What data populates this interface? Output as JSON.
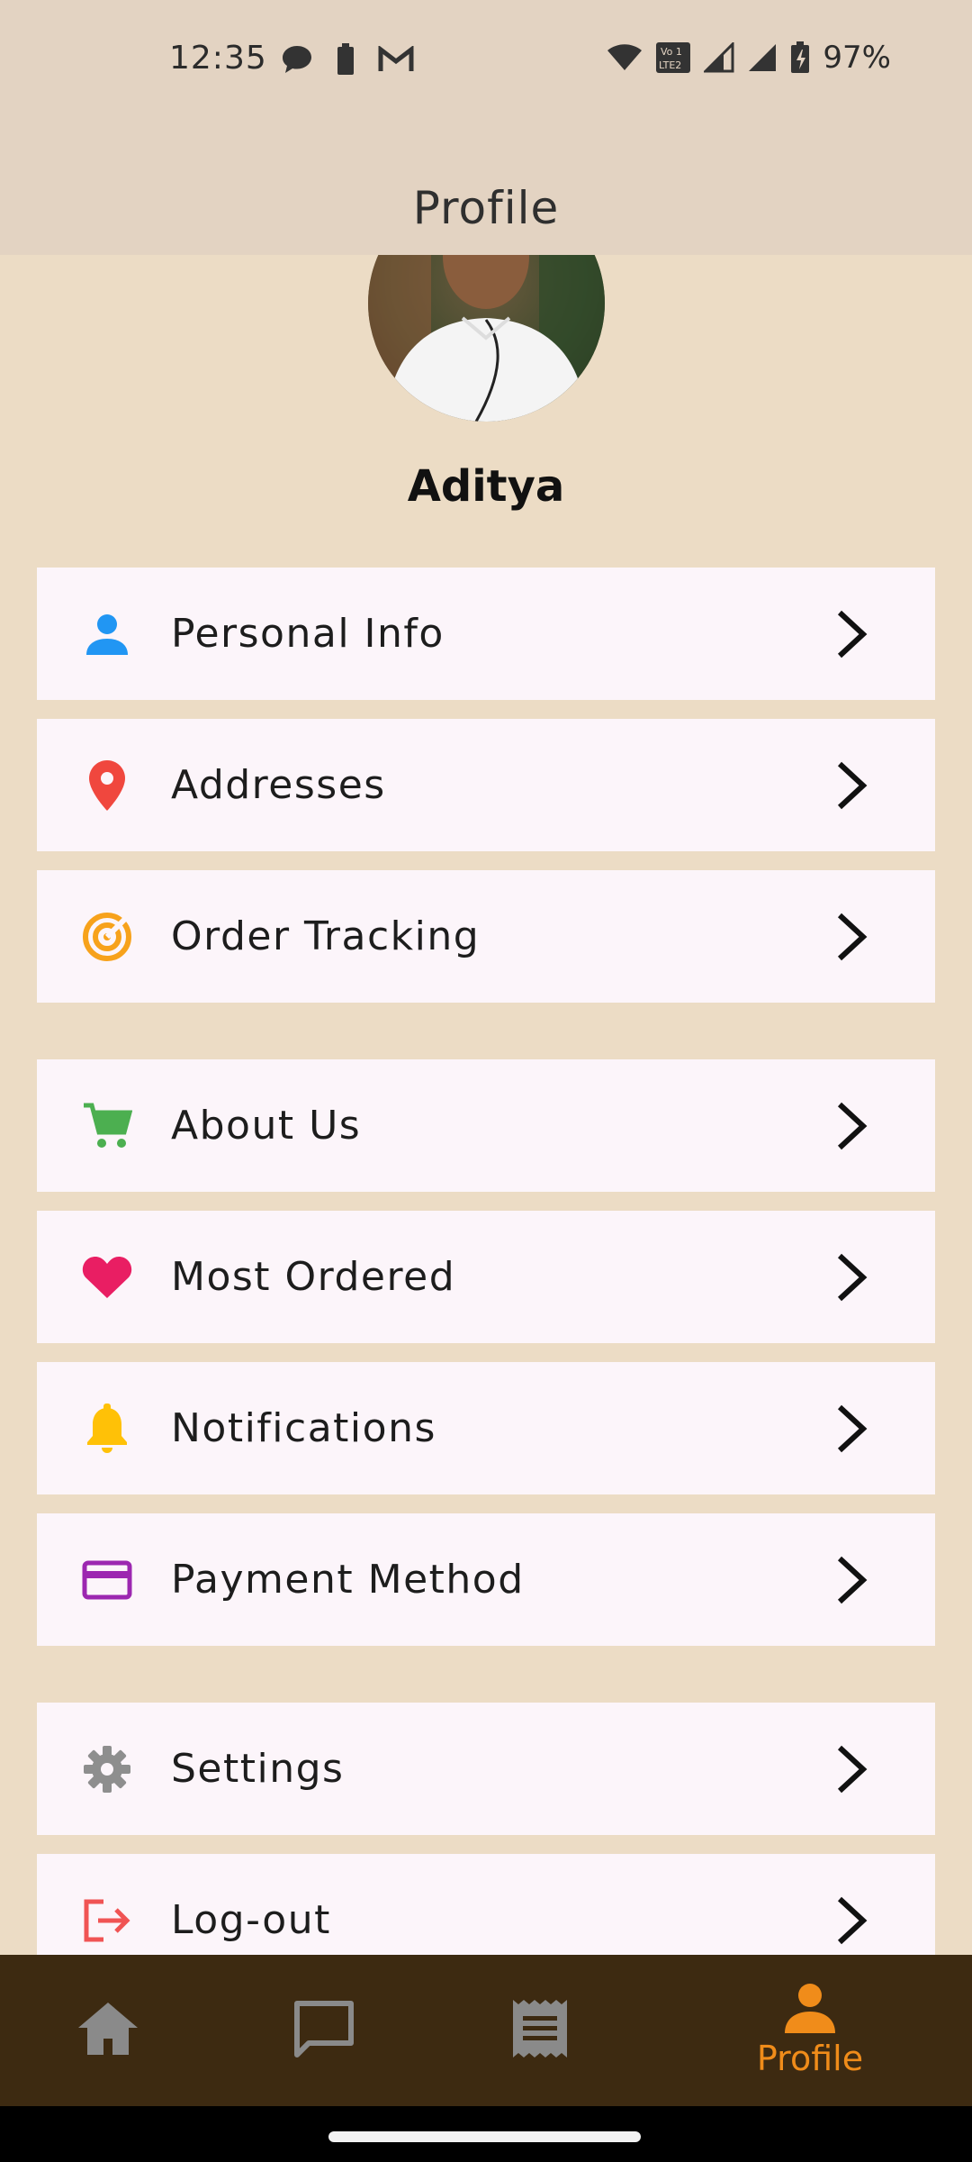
{
  "status_bar": {
    "time": "12:35",
    "battery_percent": "97%",
    "left_icons": [
      "chat-bubble-icon",
      "battery-saver-icon",
      "gmail-icon"
    ],
    "right_icons": [
      "wifi-icon",
      "volte-icon",
      "signal-icon",
      "signal-icon",
      "battery-charging-icon"
    ]
  },
  "app_bar": {
    "title": "Profile"
  },
  "profile": {
    "name": "Aditya",
    "avatar_icon": "user-photo"
  },
  "menu": {
    "items": [
      {
        "label": "Personal Info",
        "icon": "person-icon",
        "color": "#2196f3"
      },
      {
        "label": "Addresses",
        "icon": "location-pin-icon",
        "color": "#f0473e"
      },
      {
        "label": "Order Tracking",
        "icon": "radar-target-icon",
        "color": "#f7a21b"
      },
      {
        "label": "About Us",
        "icon": "cart-icon",
        "color": "#4caf50"
      },
      {
        "label": "Most Ordered",
        "icon": "heart-icon",
        "color": "#e91e63"
      },
      {
        "label": "Notifications",
        "icon": "bell-icon",
        "color": "#ffc107"
      },
      {
        "label": "Payment Method",
        "icon": "credit-card-icon",
        "color": "#9c27b0"
      },
      {
        "label": "Settings",
        "icon": "gear-icon",
        "color": "#8e8e8e"
      },
      {
        "label": "Log-out",
        "icon": "logout-icon",
        "color": "#f05454"
      }
    ]
  },
  "bottom_nav": {
    "items": [
      {
        "icon": "home-icon",
        "label": ""
      },
      {
        "icon": "chat-icon",
        "label": ""
      },
      {
        "icon": "receipt-icon",
        "label": ""
      },
      {
        "icon": "profile-icon",
        "label": "Profile",
        "active": true
      }
    ],
    "active_color": "#f08c1a",
    "inactive_color": "#8a8a8a"
  }
}
